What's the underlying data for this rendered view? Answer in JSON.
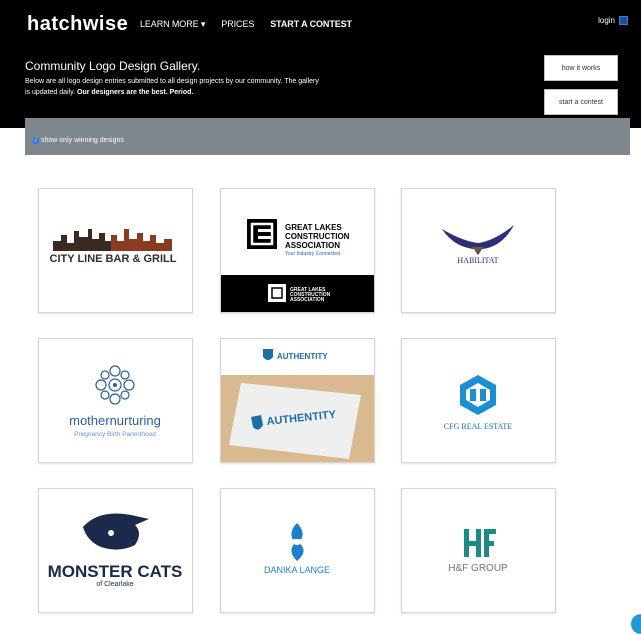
{
  "header": {
    "brand": "hatchwise",
    "nav": [
      {
        "label": "LEARN MORE ▾",
        "strong": false
      },
      {
        "label": "PRICES",
        "strong": false
      },
      {
        "label": "START A CONTEST",
        "strong": true
      }
    ],
    "login_label": "login"
  },
  "hero": {
    "title": "Community Logo Design Gallery.",
    "description": "Below are all logo design entries submitted to all design projects by our community. The gallery is updated daily.",
    "description_emphasis": "Our designers are the best. Period.",
    "how_it_works_label": "how it works",
    "start_contest_label": "start a contest"
  },
  "filter": {
    "label": "show only winning designs",
    "checked": true
  },
  "gallery": {
    "tiles": [
      {
        "text": "CITY LINE BAR & GRILL"
      },
      {
        "text_lines": [
          "GREAT LAKES",
          "CONSTRUCTION",
          "ASSOCIATION"
        ],
        "tagline": "Your Industry Connected"
      },
      {
        "text": "HABILITAT"
      },
      {
        "text": "mothernurturing",
        "tagline": "Pregnancy Birth Parenthood"
      },
      {
        "text": "AUTHENTITY"
      },
      {
        "text": "CFG REAL ESTATE"
      },
      {
        "text": "MONSTER CATS",
        "tagline": "of Clearlake"
      },
      {
        "text": "DANIKA LANGE"
      },
      {
        "text": "H&F GROUP"
      }
    ]
  },
  "colors": {
    "header_bg": "#000000",
    "filter_bar_bg": "#7e878b",
    "checkbox_blue": "#3478f6",
    "accent_blue": "#1f9bd6"
  }
}
